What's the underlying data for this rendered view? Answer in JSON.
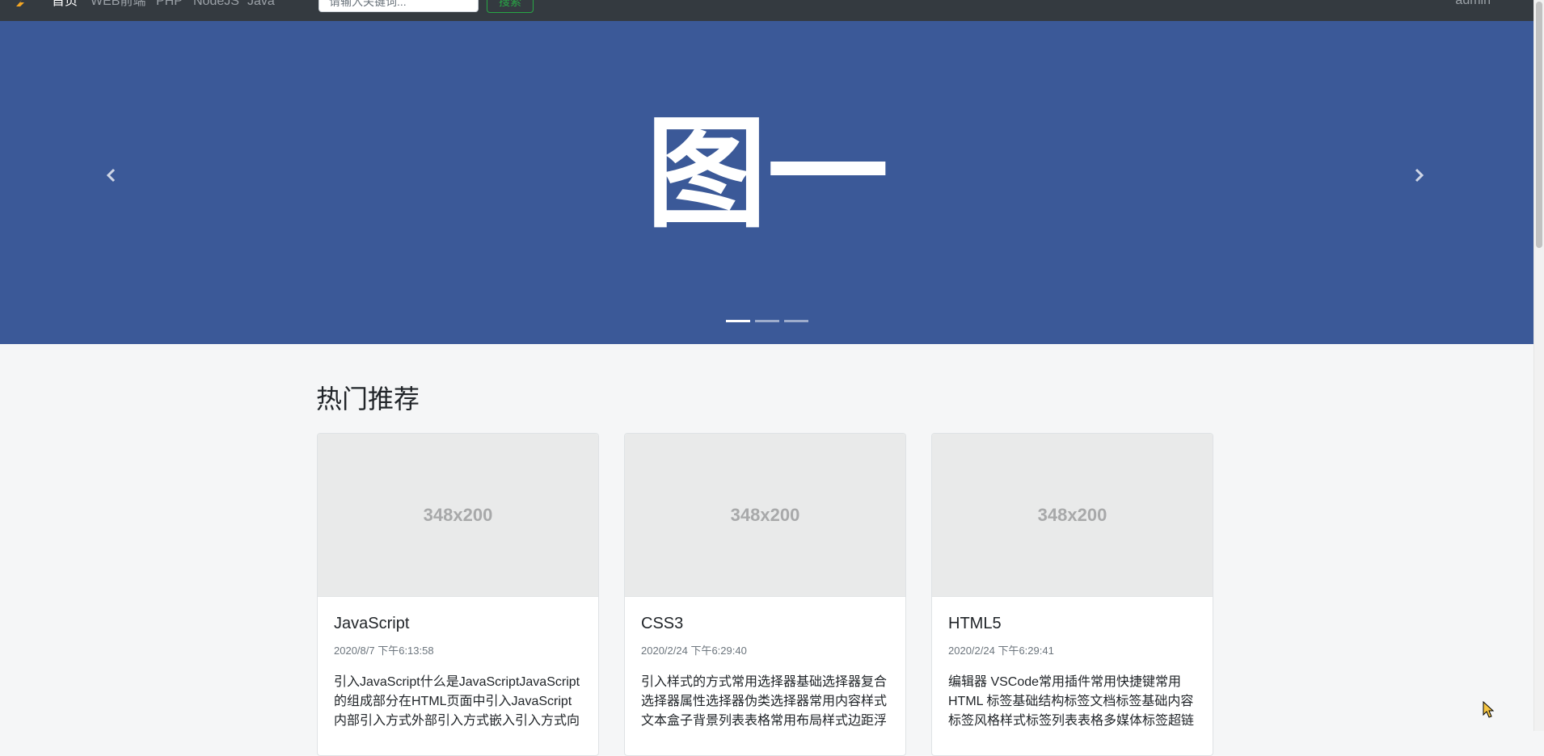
{
  "navbar": {
    "brand_icon": "lightning-logo-icon",
    "links": [
      {
        "label": "首页",
        "active": true
      },
      {
        "label": "WEB前端"
      },
      {
        "label": "PHP"
      },
      {
        "label": "NodeJS"
      },
      {
        "label": "Java"
      }
    ],
    "search_placeholder": "请输入关键词...",
    "search_button": "搜索",
    "user": "admin"
  },
  "carousel": {
    "slide_title": "图一",
    "background": "#3b5998",
    "prev_icon": "chevron-left-icon",
    "next_icon": "chevron-right-icon",
    "indicators": [
      true,
      false,
      false
    ]
  },
  "section": {
    "title": "热门推荐"
  },
  "cards": [
    {
      "image_text": "348x200",
      "title": "JavaScript",
      "date": "2020/8/7 下午6:13:58",
      "text": "引入JavaScript什么是JavaScriptJavaScript的组成部分在HTML页面中引入JavaScript内部引入方式外部引入方式嵌入引入方式向"
    },
    {
      "image_text": "348x200",
      "title": "CSS3",
      "date": "2020/2/24 下午6:29:40",
      "text": "引入样式的方式常用选择器基础选择器复合选择器属性选择器伪类选择器常用内容样式文本盒子背景列表表格常用布局样式边距浮"
    },
    {
      "image_text": "348x200",
      "title": "HTML5",
      "date": "2020/2/24 下午6:29:41",
      "text": "编辑器 VSCode常用插件常用快捷键常用 HTML 标签基础结构标签文档标签基础内容标签风格样式标签列表表格多媒体标签超链"
    }
  ]
}
